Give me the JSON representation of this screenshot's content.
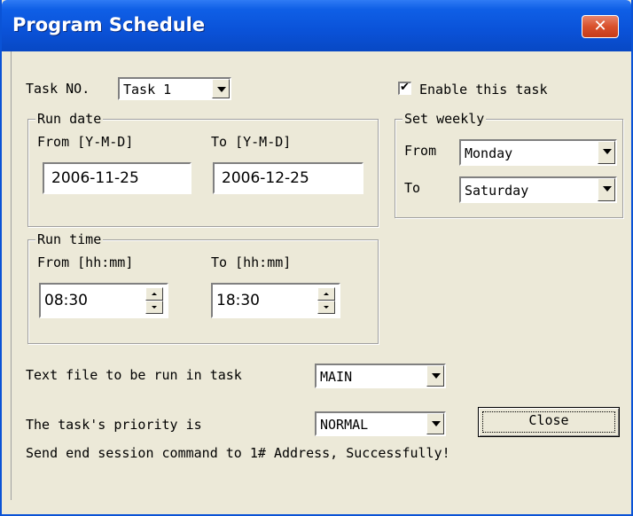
{
  "window": {
    "title": "Program Schedule",
    "close_glyph": "✕",
    "accent_color": "#0a52d8"
  },
  "task": {
    "label": "Task NO.",
    "value": "Task 1"
  },
  "enable": {
    "label": "Enable this task",
    "checked": true,
    "check_glyph": "✔"
  },
  "run_date": {
    "group_label": "Run date",
    "from_label": "From [Y-M-D]",
    "to_label": "To [Y-M-D]",
    "from_value": "2006-11-25",
    "to_value": "2006-12-25"
  },
  "weekly": {
    "group_label": "Set weekly",
    "from_label": "From",
    "to_label": "To",
    "from_value": "Monday",
    "to_value": "Saturday"
  },
  "run_time": {
    "group_label": "Run time",
    "from_label": "From [hh:mm]",
    "to_label": "To [hh:mm]",
    "from_value": "08:30",
    "to_value": "18:30"
  },
  "text_file": {
    "label": "Text file to be run in task",
    "value": "MAIN"
  },
  "priority": {
    "label": "The task's priority is",
    "value": "NORMAL"
  },
  "close_button": {
    "label": "Close"
  },
  "status": {
    "message": "Send end session command to 1# Address, Successfully!"
  }
}
